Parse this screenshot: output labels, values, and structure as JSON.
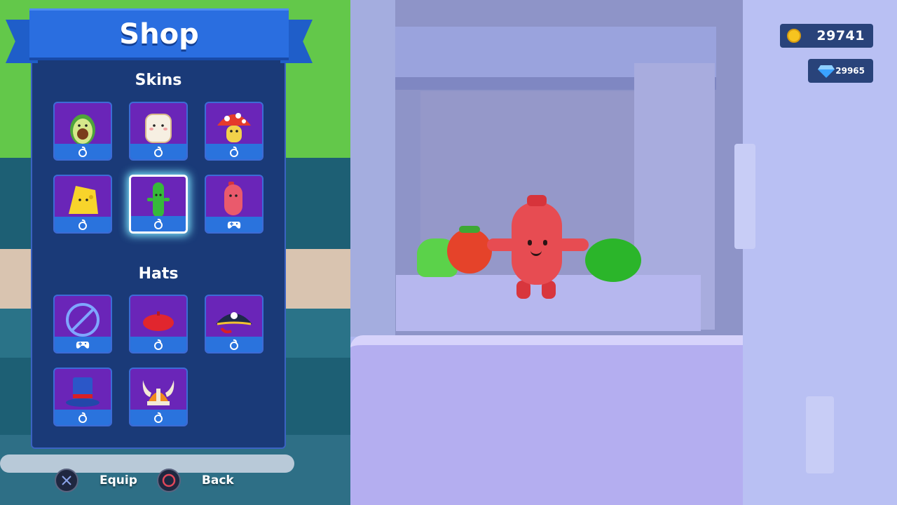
{
  "shop": {
    "title": "Shop",
    "skins_heading": "Skins",
    "hats_heading": "Hats",
    "skins": [
      {
        "name": "avocado",
        "lock": "lock-icon",
        "selected": false
      },
      {
        "name": "toast",
        "lock": "lock-icon",
        "selected": false
      },
      {
        "name": "mushroom",
        "lock": "lock-icon",
        "selected": false
      },
      {
        "name": "cheese",
        "lock": "lock-icon",
        "selected": false
      },
      {
        "name": "cucumber",
        "lock": "lock-icon",
        "selected": true
      },
      {
        "name": "sausage",
        "lock": "gamepad-icon",
        "selected": false
      }
    ],
    "hats": [
      {
        "name": "no-hat",
        "lock": "gamepad-icon"
      },
      {
        "name": "beret",
        "lock": "lock-icon"
      },
      {
        "name": "pirate-hat",
        "lock": "lock-icon"
      },
      {
        "name": "top-hat",
        "lock": "lock-icon"
      },
      {
        "name": "viking-helmet",
        "lock": "lock-icon"
      }
    ]
  },
  "currency": {
    "coins": "29741",
    "gems": "29965"
  },
  "controls": {
    "equip_label": "Equip",
    "back_label": "Back"
  },
  "colors": {
    "panel": "#1a3a78",
    "ribbon": "#2a6ee0",
    "item_bg": "#6a25b8",
    "item_banner": "#2a73dd",
    "selected_glow": "#7ee7ff",
    "coin": "#f7c41f",
    "gem": "#3aa2ff"
  }
}
